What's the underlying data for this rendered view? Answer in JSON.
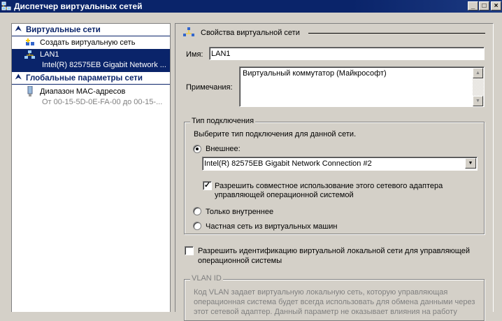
{
  "window": {
    "title": "Диспетчер виртуальных сетей",
    "min": "_",
    "max": "□",
    "close": "×"
  },
  "sidebar": {
    "virtual_networks_header": "Виртуальные сети",
    "create_network": "Создать виртуальную сеть",
    "networks": [
      {
        "name": "LAN1",
        "adapter": "Intel(R) 82575EB Gigabit Network ..."
      }
    ],
    "global_header": "Глобальные параметры сети",
    "mac_range": {
      "label": "Диапазон MAC-адресов",
      "value": "От 00-15-5D-0E-FA-00 до 00-15-..."
    }
  },
  "properties": {
    "section_title": "Свойства виртуальной сети",
    "name_label": "Имя:",
    "name_value": "LAN1",
    "notes_label": "Примечания:",
    "notes_value": "Виртуальный коммутатор (Майкрософт)",
    "connection": {
      "legend": "Тип подключения",
      "prompt": "Выберите тип подключения для данной сети.",
      "external_label": "Внешнее:",
      "external_selected": true,
      "adapter_value": "Intel(R) 82575EB Gigabit Network Connection #2",
      "allow_share_line1": "Разрешить совместное использование этого сетевого адаптера",
      "allow_share_line2": "управляющей операционной системой",
      "allow_share_checked": true,
      "internal_label": "Только внутреннее",
      "private_label": "Частная сеть из виртуальных машин"
    },
    "vlan_enable_line1": "Разрешить идентификацию виртуальной локальной сети для управляющей",
    "vlan_enable_line2": "операционной системы",
    "vlan_enable_checked": false,
    "vlan": {
      "legend": "VLAN ID",
      "desc_line1": "Код VLAN задает виртуальную локальную сеть, которую управляющая",
      "desc_line2": "операционная система будет всегда использовать для обмена данными через",
      "desc_line3": "этот сетевой адаптер. Данный параметр не оказывает влияния на работу"
    }
  }
}
